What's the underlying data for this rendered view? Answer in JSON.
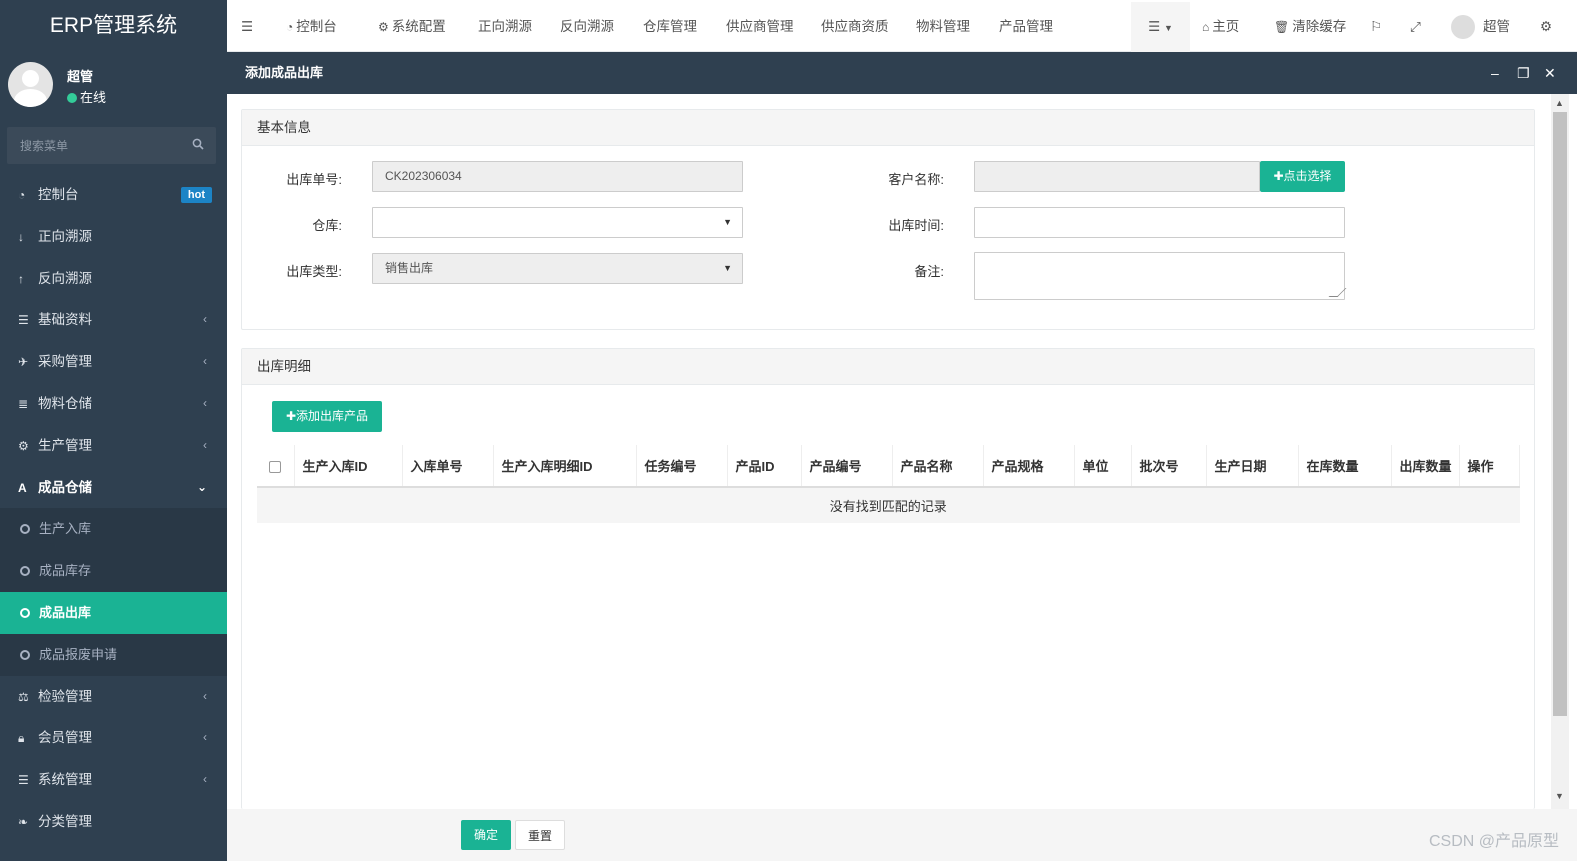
{
  "app": {
    "title": "ERP管理系统"
  },
  "user": {
    "name": "超管",
    "status": "在线"
  },
  "search": {
    "placeholder": "搜索菜单"
  },
  "menu": [
    {
      "label": "控制台",
      "icon": "dashboard-icon",
      "badge": "hot"
    },
    {
      "label": "正向溯源",
      "icon": "arrow-down-icon"
    },
    {
      "label": "反向溯源",
      "icon": "arrow-up-icon"
    },
    {
      "label": "基础资料",
      "icon": "list-icon"
    },
    {
      "label": "采购管理",
      "icon": "plane-icon"
    },
    {
      "label": "物料仓储",
      "icon": "database-icon"
    },
    {
      "label": "生产管理",
      "icon": "gears-icon"
    },
    {
      "label": "成品仓储",
      "icon": "font-icon",
      "expanded": true,
      "children": [
        "生产入库",
        "成品库存",
        "成品出库",
        "成品报废申请"
      ],
      "active_child": "成品出库"
    },
    {
      "label": "检验管理",
      "icon": "balance-icon"
    },
    {
      "label": "会员管理",
      "icon": "lock-icon"
    },
    {
      "label": "系统管理",
      "icon": "list-icon"
    },
    {
      "label": "分类管理",
      "icon": "leaf-icon"
    }
  ],
  "topnav": {
    "items": [
      "控制台",
      "系统配置",
      "正向溯源",
      "反向溯源",
      "仓库管理",
      "供应商管理",
      "供应商资质",
      "物料管理",
      "产品管理"
    ],
    "home": "主页",
    "clear_cache": "清除缓存",
    "user": "超管"
  },
  "modal": {
    "title": "添加成品出库"
  },
  "basic_info": {
    "title": "基本信息",
    "order_no_label": "出库单号:",
    "order_no_value": "CK202306034",
    "warehouse_label": "仓库:",
    "warehouse_value": "",
    "out_type_label": "出库类型:",
    "out_type_value": "销售出库",
    "customer_label": "客户名称:",
    "customer_value": "",
    "select_button": "点击选择",
    "out_time_label": "出库时间:",
    "out_time_value": "",
    "remark_label": "备注:",
    "remark_value": ""
  },
  "detail": {
    "title": "出库明细",
    "add_button": "添加出库产品",
    "columns": [
      "生产入库ID",
      "入库单号",
      "生产入库明细ID",
      "任务编号",
      "产品ID",
      "产品编号",
      "产品名称",
      "产品规格",
      "单位",
      "批次号",
      "生产日期",
      "在库数量",
      "出库数量",
      "操作"
    ],
    "empty_text": "没有找到匹配的记录"
  },
  "footer": {
    "confirm": "确定",
    "reset": "重置",
    "watermark": "CSDN @产品原型"
  },
  "colors": {
    "sidebar": "#2f4050",
    "accent": "#1ab394",
    "badge": "#1c84c6"
  }
}
